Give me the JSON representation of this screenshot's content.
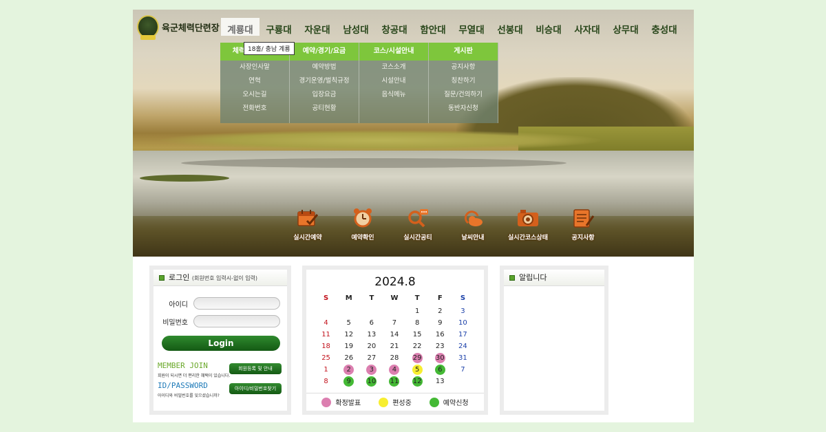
{
  "site": {
    "name": "육군체력단련장"
  },
  "nav": {
    "items": [
      "계룡대",
      "구룡대",
      "자운대",
      "남성대",
      "창공대",
      "함안대",
      "무열대",
      "선봉대",
      "비승대",
      "사자대",
      "상무대",
      "충성대"
    ],
    "tooltip": "18홀/ 충남 계룡"
  },
  "dropdown": [
    {
      "head": "체력단련장소개",
      "items": [
        "사장인사말",
        "연혁",
        "오시는길",
        "전화번호"
      ]
    },
    {
      "head": "예약/경기/요금",
      "items": [
        "예약방법",
        "경기운영/벌칙규정",
        "입장요금",
        "공티현황"
      ]
    },
    {
      "head": "코스/시설안내",
      "items": [
        "코스소개",
        "시설안내",
        "음식메뉴"
      ]
    },
    {
      "head": "게시판",
      "items": [
        "공지사항",
        "칭찬하기",
        "질문/건의하기",
        "동반자신청"
      ]
    }
  ],
  "quick": [
    {
      "label": "실시간예약",
      "icon": "calendar-check-icon"
    },
    {
      "label": "예약확인",
      "icon": "alarm-clock-icon"
    },
    {
      "label": "실시간공티",
      "icon": "magnifier-chat-icon"
    },
    {
      "label": "날씨안내",
      "icon": "weather-icon"
    },
    {
      "label": "실시간코스상태",
      "icon": "camera-icon"
    },
    {
      "label": "공지사항",
      "icon": "notepad-pen-icon"
    }
  ],
  "login": {
    "title": "로그인",
    "hint": "(회원번호 입력시-없이 입력)",
    "id_label": "아이디",
    "pw_label": "비밀번호",
    "button": "Login",
    "member_join": "MEMBER JOIN",
    "member_join_desc": "회원이 되시면 더 편리한 혜택이 있습니다.",
    "member_join_btn": "회원등록 및 안내",
    "idpw": "ID/PASSWORD",
    "idpw_desc": "아이디와 비밀번호를 잊으셨습니까?",
    "idpw_btn": "아이디/비밀번호찾기"
  },
  "calendar": {
    "title": "2024.8",
    "dow": [
      "S",
      "M",
      "T",
      "W",
      "T",
      "F",
      "S"
    ],
    "weeks": [
      [
        null,
        null,
        null,
        null,
        {
          "d": "1"
        },
        {
          "d": "2"
        },
        {
          "d": "3"
        }
      ],
      [
        {
          "d": "4"
        },
        {
          "d": "5"
        },
        {
          "d": "6"
        },
        {
          "d": "7"
        },
        {
          "d": "8"
        },
        {
          "d": "9"
        },
        {
          "d": "10"
        }
      ],
      [
        {
          "d": "11"
        },
        {
          "d": "12"
        },
        {
          "d": "13"
        },
        {
          "d": "14"
        },
        {
          "d": "15"
        },
        {
          "d": "16"
        },
        {
          "d": "17"
        }
      ],
      [
        {
          "d": "18"
        },
        {
          "d": "19"
        },
        {
          "d": "20"
        },
        {
          "d": "21"
        },
        {
          "d": "22"
        },
        {
          "d": "23"
        },
        {
          "d": "24"
        }
      ],
      [
        {
          "d": "25"
        },
        {
          "d": "26"
        },
        {
          "d": "27"
        },
        {
          "d": "28"
        },
        {
          "d": "29",
          "s": "pink"
        },
        {
          "d": "30",
          "s": "pink"
        },
        {
          "d": "31"
        }
      ],
      [
        {
          "d": "1"
        },
        {
          "d": "2",
          "s": "pink"
        },
        {
          "d": "3",
          "s": "pink"
        },
        {
          "d": "4",
          "s": "pink"
        },
        {
          "d": "5",
          "s": "yellow"
        },
        {
          "d": "6",
          "s": "green"
        },
        {
          "d": "7"
        }
      ],
      [
        {
          "d": "8"
        },
        {
          "d": "9",
          "s": "green"
        },
        {
          "d": "10",
          "s": "green"
        },
        {
          "d": "11",
          "s": "green"
        },
        {
          "d": "12",
          "s": "green"
        },
        {
          "d": "13"
        },
        null
      ]
    ],
    "legend": [
      {
        "label": "확정발표",
        "color": "#dc7fb0"
      },
      {
        "label": "편성중",
        "color": "#f7ee30"
      },
      {
        "label": "예약신청",
        "color": "#44b935"
      }
    ]
  },
  "notice": {
    "title": "알립니다"
  }
}
